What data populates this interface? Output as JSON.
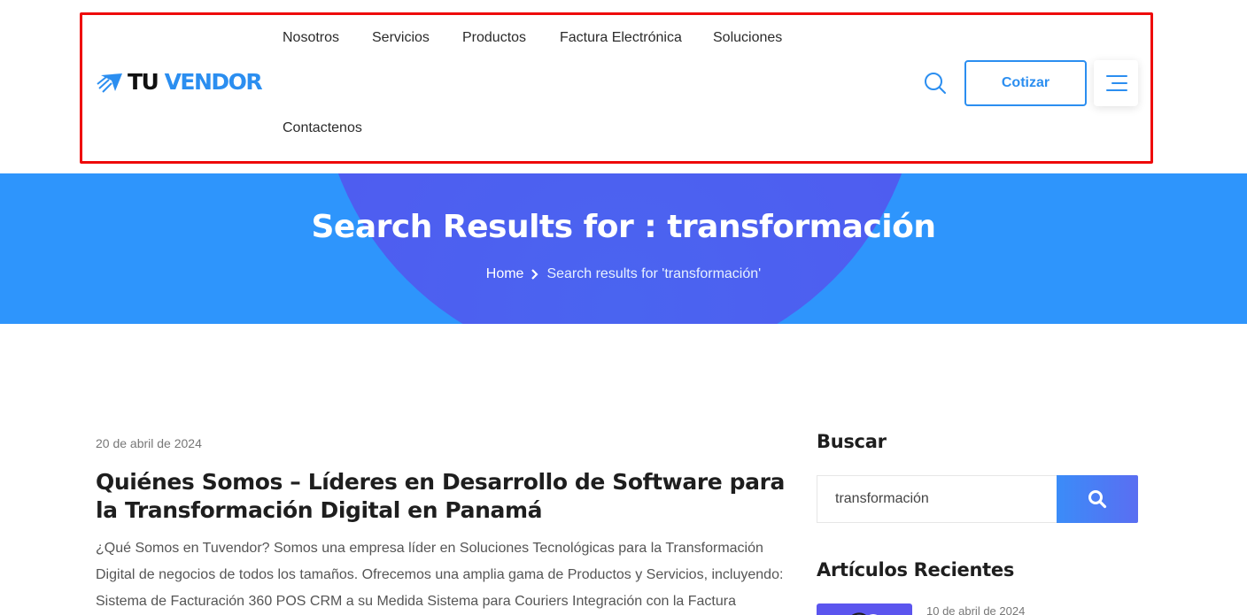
{
  "header": {
    "logo": {
      "part1": "TU",
      "part2": "VENDOR"
    },
    "nav": [
      {
        "label": "Nosotros"
      },
      {
        "label": "Servicios"
      },
      {
        "label": "Productos"
      },
      {
        "label": "Factura Electrónica"
      },
      {
        "label": "Soluciones"
      },
      {
        "label": "Contactenos"
      }
    ],
    "cta_label": "Cotizar",
    "search_icon": "search-icon",
    "menu_icon": "hamburger-menu-icon"
  },
  "hero": {
    "title": "Search Results for : transformación",
    "breadcrumb": {
      "home": "Home",
      "current": "Search results for 'transformación'"
    }
  },
  "post": {
    "date": "20 de abril de 2024",
    "title": "Quiénes Somos – Líderes en Desarrollo de Software para la Transformación Digital en Panamá",
    "excerpt": "¿Qué Somos en Tuvendor? Somos una empresa líder en Soluciones Tecnológicas para la Transformación Digital de negocios de todos los tamaños. Ofrecemos una amplia gama de Productos y Servicios, incluyendo: Sistema de Facturación 360 POS CRM a su Medida Sistema para Couriers Integración con la Factura"
  },
  "sidebar": {
    "search_title": "Buscar",
    "search_value": "transformación",
    "recent_title": "Artículos Recientes",
    "recent_items": [
      {
        "date": "10 de abril de 2024"
      }
    ]
  },
  "colors": {
    "brand": "#2b8ef0",
    "hero_bg": "#2e95fc",
    "highlight": "#ee0a0a"
  }
}
